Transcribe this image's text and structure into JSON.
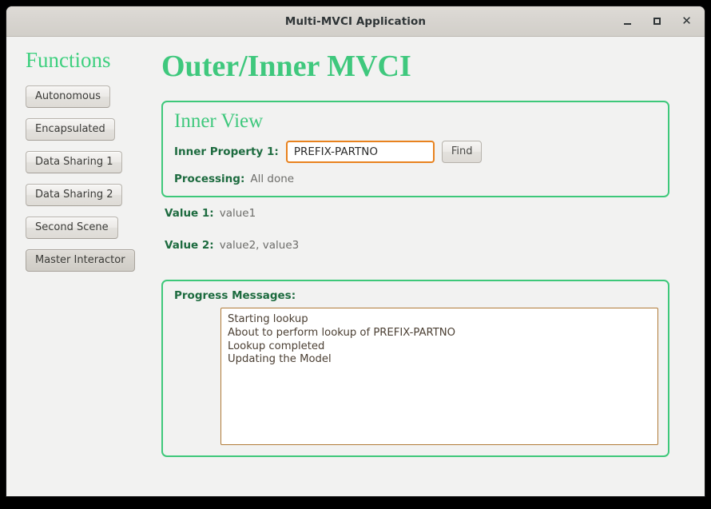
{
  "window": {
    "title": "Multi-MVCI Application",
    "controls": [
      {
        "name": "minimize-button",
        "glyph": "—"
      },
      {
        "name": "maximize-button",
        "glyph": "□"
      },
      {
        "name": "close-button",
        "glyph": "✕"
      }
    ]
  },
  "sidebar": {
    "title": "Functions",
    "items": [
      {
        "label": "Autonomous",
        "active": false
      },
      {
        "label": "Encapsulated",
        "active": false
      },
      {
        "label": "Data Sharing 1",
        "active": false
      },
      {
        "label": "Data Sharing 2",
        "active": false
      },
      {
        "label": "Second Scene",
        "active": false
      },
      {
        "label": "Master Interactor",
        "active": true
      }
    ]
  },
  "main": {
    "page_title": "Outer/Inner MVCI",
    "inner_view": {
      "title": "Inner View",
      "property_label": "Inner Property 1:",
      "property_value": "PREFIX-PARTNO",
      "property_placeholder": "",
      "find_label": "Find",
      "processing_label": "Processing:",
      "processing_value": "All done"
    },
    "values": [
      {
        "label": "Value 1:",
        "value": "value1"
      },
      {
        "label": "Value 2:",
        "value": "value2, value3"
      }
    ],
    "progress": {
      "label": "Progress Messages:",
      "messages": [
        "Starting lookup",
        "About to perform lookup of PREFIX-PARTNO",
        "Lookup completed",
        "Updating the Model"
      ]
    }
  },
  "colors": {
    "accent_green": "#3ec87a",
    "title_green": "#3fc87d",
    "label_green": "#1d6b3f",
    "input_orange": "#e8821e",
    "textarea_border": "#b07b38",
    "window_bg": "#f2f2f1",
    "titlebar_bg": "#d6d3ce"
  }
}
